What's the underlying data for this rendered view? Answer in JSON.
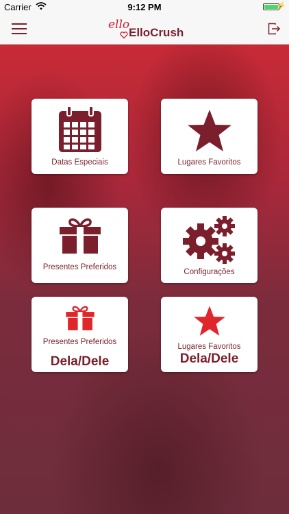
{
  "status": {
    "carrier": "Carrier",
    "time": "9:12 PM"
  },
  "header": {
    "logo_script": "ello",
    "logo_brand": "ElloCrush"
  },
  "tiles": [
    {
      "label": "Datas Especiais",
      "icon": "calendar-icon"
    },
    {
      "label": "Lugares Favoritos",
      "icon": "star-icon"
    },
    {
      "label": "Presentes Preferidos",
      "icon": "gift-icon"
    },
    {
      "label": "Configurações",
      "icon": "gears-icon"
    },
    {
      "label": "Presentes Preferidos",
      "sublabel": "Dela/Dele",
      "icon": "gift-icon"
    },
    {
      "label": "Lugares Favoritos",
      "sublabel": "Dela/Dele",
      "icon": "star-icon"
    }
  ],
  "colors": {
    "primary": "#7a1f2b",
    "accent": "#e0252b",
    "background": "#a8283a"
  }
}
